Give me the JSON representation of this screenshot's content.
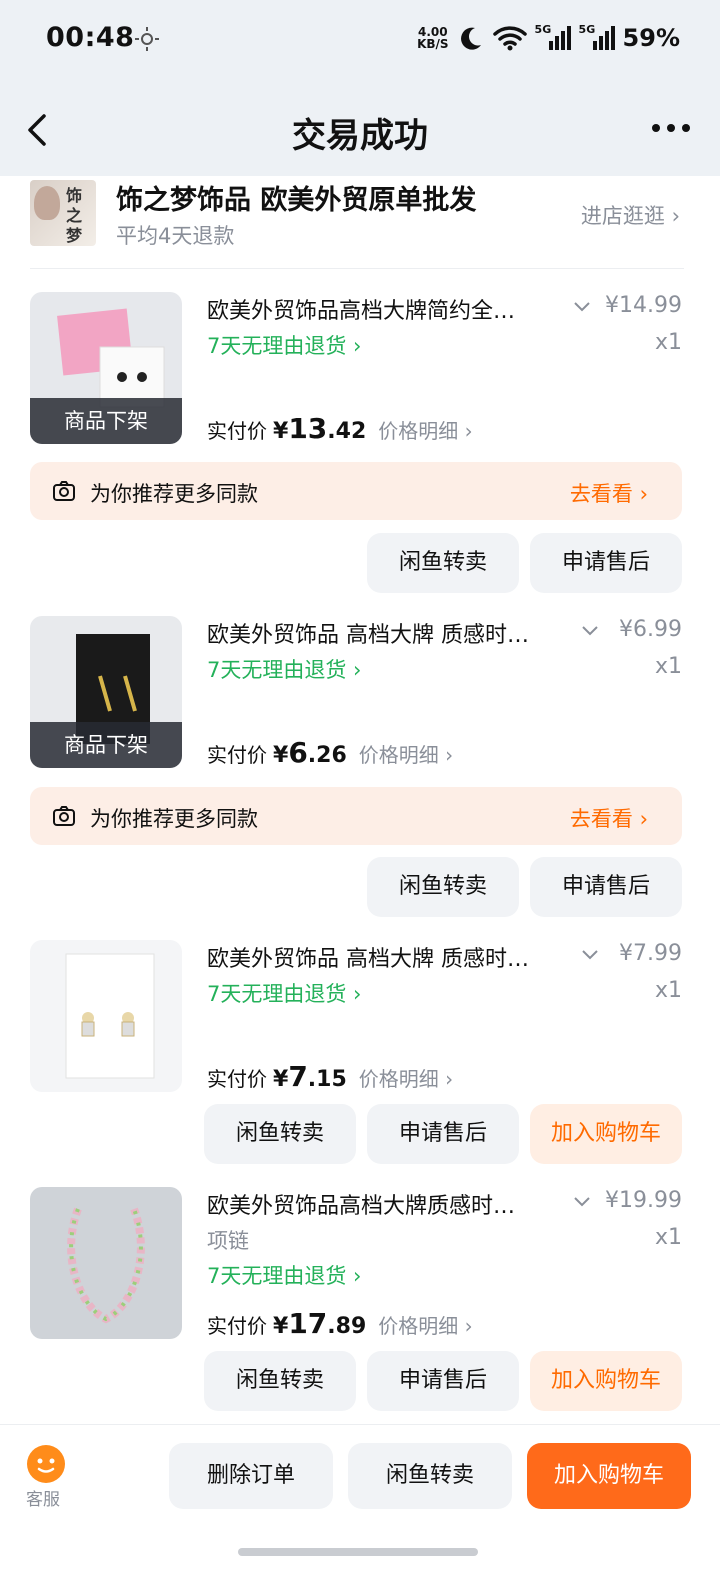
{
  "status_bar": {
    "time": "00:48",
    "net_speed_value": "4.00",
    "net_speed_unit": "KB/S",
    "signal_1": "5G",
    "signal_2": "5G",
    "battery": "59%"
  },
  "nav": {
    "title": "交易成功"
  },
  "shop": {
    "name": "饰之梦饰品 欧美外贸原单批发",
    "subtitle": "平均4天退款",
    "enter_label": "进店逛逛 ›",
    "logo_text": "饰之梦"
  },
  "products": [
    {
      "title": "欧美外贸饰品高档大牌简约全…",
      "price": "¥14.99",
      "qty": "x1",
      "return_policy": "7天无理由退货 ›",
      "status_label": "商品下架",
      "paid_label": "实付价",
      "paid_yen": "¥",
      "paid_int": "13",
      "paid_dec": ".42",
      "price_detail": "价格明细 ›"
    },
    {
      "title": "欧美外贸饰品 高档大牌 质感时…",
      "price": "¥6.99",
      "qty": "x1",
      "return_policy": "7天无理由退货 ›",
      "status_label": "商品下架",
      "paid_label": "实付价",
      "paid_yen": "¥",
      "paid_int": "6",
      "paid_dec": ".26",
      "price_detail": "价格明细 ›"
    },
    {
      "title": "欧美外贸饰品 高档大牌 质感时…",
      "price": "¥7.99",
      "qty": "x1",
      "return_policy": "7天无理由退货 ›",
      "paid_label": "实付价",
      "paid_yen": "¥",
      "paid_int": "7",
      "paid_dec": ".15",
      "price_detail": "价格明细 ›"
    },
    {
      "title": "欧美外贸饰品高档大牌质感时…",
      "price": "¥19.99",
      "qty": "x1",
      "spec": "项链",
      "return_policy": "7天无理由退货 ›",
      "paid_label": "实付价",
      "paid_yen": "¥",
      "paid_int": "17",
      "paid_dec": ".89",
      "price_detail": "价格明细 ›"
    }
  ],
  "recommend": {
    "text": "为你推荐更多同款",
    "action": "去看看 ›"
  },
  "buttons": {
    "resell": "闲鱼转卖",
    "after_sale": "申请售后",
    "add_cart": "加入购物车"
  },
  "bottom_bar": {
    "service_label": "客服",
    "delete_order": "删除订单",
    "resell": "闲鱼转卖",
    "add_cart": "加入购物车"
  },
  "colors": {
    "accent": "#ff6a00",
    "green": "#24b15a",
    "primary_button": "#ff6a1a"
  }
}
